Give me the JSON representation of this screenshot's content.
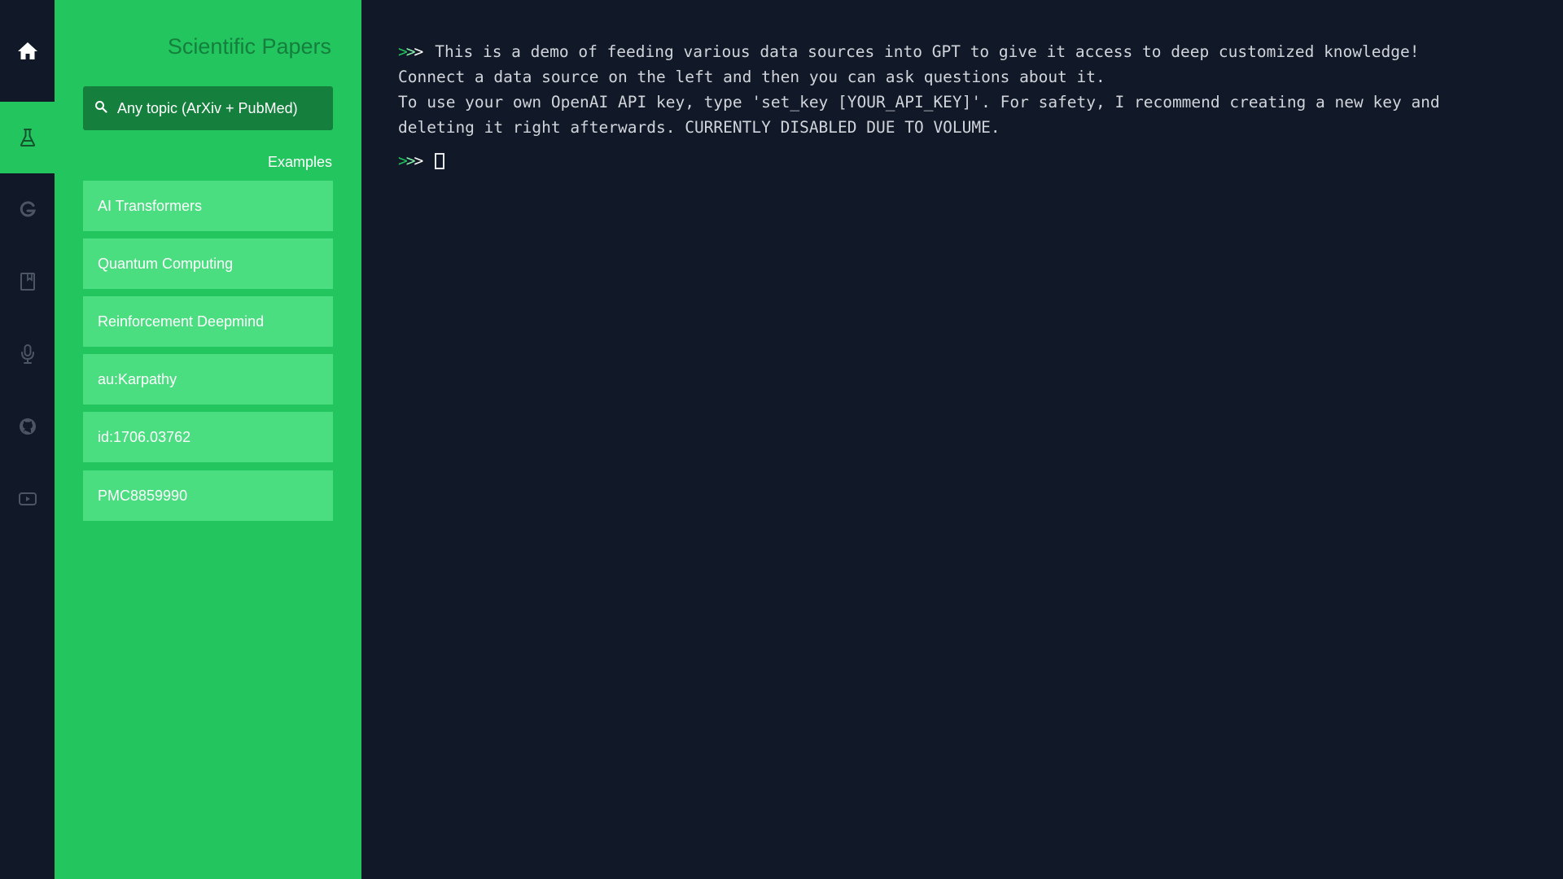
{
  "rail": {
    "items": [
      {
        "icon": "home-icon",
        "active": false
      },
      {
        "icon": "flask-icon",
        "active": true
      },
      {
        "icon": "google-icon",
        "active": false
      },
      {
        "icon": "book-icon",
        "active": false
      },
      {
        "icon": "microphone-icon",
        "active": false
      },
      {
        "icon": "github-icon",
        "active": false
      },
      {
        "icon": "youtube-icon",
        "active": false
      }
    ]
  },
  "panel": {
    "title": "Scientific Papers",
    "search": {
      "placeholder": "Any topic (ArXiv + PubMed)",
      "value": ""
    },
    "examples_label": "Examples",
    "examples": [
      "AI Transformers",
      "Quantum Computing",
      "Reinforcement Deepmind",
      "au:Karpathy",
      "id:1706.03762",
      "PMC8859990"
    ]
  },
  "terminal": {
    "prompt": ">>>",
    "output_lines": [
      "This is a demo of feeding various data sources into GPT to give it access to deep customized knowledge!",
      "Connect a data source on the left and then you can ask questions about it.",
      "To use your own OpenAI API key, type 'set_key [YOUR_API_KEY]'. For safety, I recommend creating a new key and",
      "deleting it right afterwards. CURRENTLY DISABLED DUE TO VOLUME."
    ],
    "input_value": ""
  },
  "colors": {
    "background": "#111827",
    "accent": "#22c55e",
    "accent_dark": "#15803d",
    "accent_light": "#4ade80"
  }
}
